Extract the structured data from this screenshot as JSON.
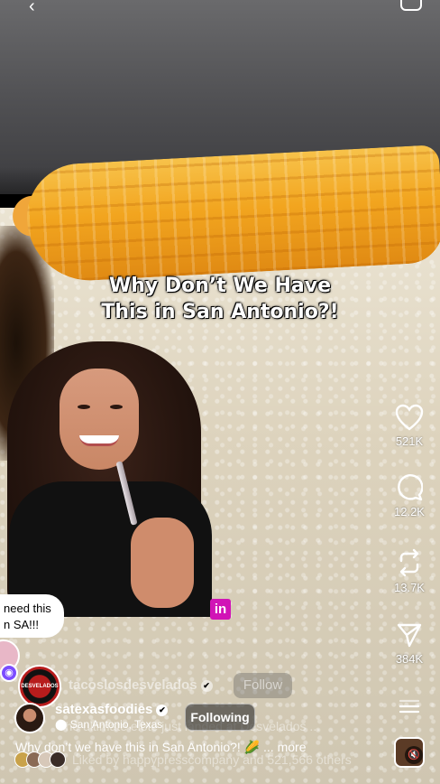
{
  "overlay": {
    "title_line1": "Why Don’t We Have",
    "title_line2": "This in San Antonio?!"
  },
  "comment_bubble": {
    "line1": "need this",
    "line2": "n SA!!!"
  },
  "content_badge": "in",
  "actions": {
    "likes": "521K",
    "comments": "12.2K",
    "reposts": "13.7K",
    "shares": "384K"
  },
  "collaborator": {
    "username": "tacoslosdesvelados",
    "follow_label": "Follow",
    "avatar_text": "DESVELADOS"
  },
  "author": {
    "username": "satexasfoodies",
    "location": "San Antonio, Texas",
    "following_label": "Following"
  },
  "caption": {
    "text": "Why don’t we have this in San Antonio?! 🌽",
    "more": "... more",
    "ghost_text": "The ultimate elote just landed at Desvelados ..."
  },
  "liked_by": {
    "text": "Liked by happypresscompany and 521,566 others"
  },
  "icons": [
    "back-arrow-icon",
    "camera-icon",
    "heart-icon",
    "comment-icon",
    "repost-icon",
    "share-icon",
    "menu-icon",
    "mute-icon",
    "verified-icon",
    "location-pin-icon"
  ]
}
